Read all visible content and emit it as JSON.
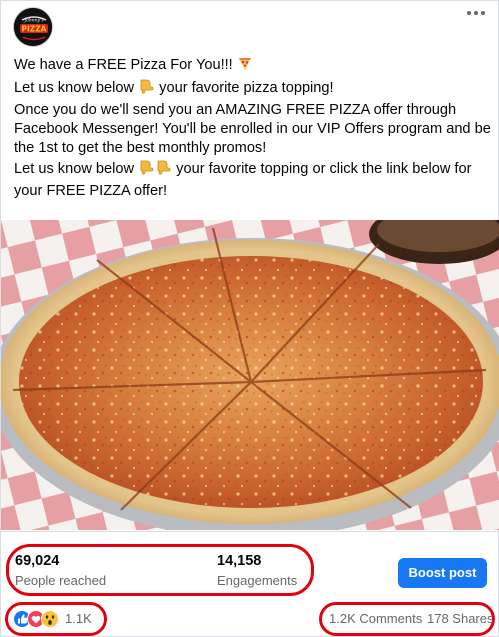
{
  "page": {
    "logo_text": "JOHNNY'S PIZZA"
  },
  "post": {
    "lines": [
      "We have a FREE Pizza For You!!! ",
      "Let us know below ",
      " your favorite pizza topping!",
      "Once you do we'll send you an AMAZING FREE PIZZA offer through",
      "Facebook Messenger! You'll be enrolled in our VIP Offers program and be",
      "the 1st to get the best monthly promos!",
      "Let us know below ",
      " your favorite topping or click the link below for",
      "your FREE PIZZA offer!"
    ],
    "image_alt": "Cheese pizza on a red and white checkered tablecloth"
  },
  "insights": {
    "people_reached_value": "69,024",
    "people_reached_label": "People reached",
    "engagements_value": "14,158",
    "engagements_label": "Engagements",
    "boost_label": "Boost post"
  },
  "engagement": {
    "reactions_count": "1.1K",
    "comments_label": "1.2K Comments",
    "shares_label": "178 Shares"
  },
  "icons": {
    "more": "more-options-icon",
    "like": "like-reaction-icon",
    "love": "love-reaction-icon",
    "wow": "wow-reaction-icon",
    "pizza": "pizza-emoji-icon",
    "point_down": "point-down-emoji-icon"
  },
  "colors": {
    "accent": "#1877f2",
    "highlight": "#e3000f",
    "secondary_text": "#65676b"
  }
}
